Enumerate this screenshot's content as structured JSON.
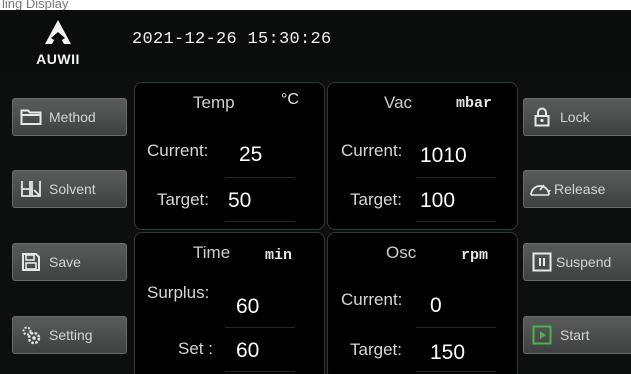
{
  "caption": "ling Display",
  "header": {
    "logo_text": "AUWII",
    "datetime": "2021-12-26 15:30:26"
  },
  "left_buttons": [
    {
      "label": "Method",
      "icon": "folder-icon"
    },
    {
      "label": "Solvent",
      "icon": "beakers-icon"
    },
    {
      "label": "Save",
      "icon": "floppy-disk-icon"
    },
    {
      "label": "Setting",
      "icon": "gears-icon"
    }
  ],
  "right_buttons": [
    {
      "label": "Lock",
      "icon": "padlock-icon"
    },
    {
      "label": "Release",
      "icon": "vacuum-gauge-icon"
    },
    {
      "label": "Suspend",
      "icon": "pause-icon"
    },
    {
      "label": "Start",
      "icon": "play-icon"
    }
  ],
  "panels": {
    "temp": {
      "title": "Temp",
      "unit": "°C",
      "row1_label": "Current:",
      "row1_value": "25",
      "row2_label": "Target:",
      "row2_value": "50"
    },
    "vac": {
      "title": "Vac",
      "unit": "mbar",
      "row1_label": "Current:",
      "row1_value": "1010",
      "row2_label": "Target:",
      "row2_value": "100"
    },
    "time": {
      "title": "Time",
      "unit": "min",
      "row1_label": "Surplus:",
      "row1_value": "60",
      "row2_label": "Set :",
      "row2_value": "60"
    },
    "osc": {
      "title": "Osc",
      "unit": "rpm",
      "row1_label": "Current:",
      "row1_value": "0",
      "row2_label": "Target:",
      "row2_value": "150"
    }
  },
  "colors": {
    "background": "#0d0f0f",
    "panel": "#000000",
    "button": "#4a4c4c",
    "play_accent": "#4bb34b"
  }
}
